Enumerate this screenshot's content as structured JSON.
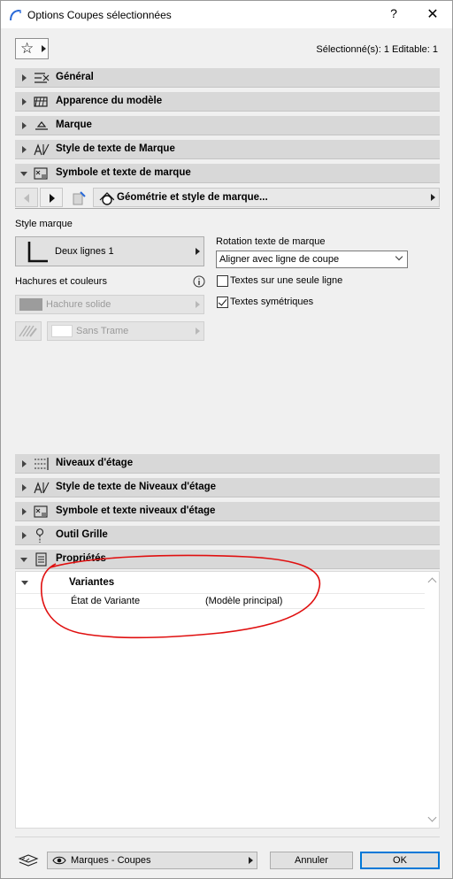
{
  "window": {
    "title": "Options Coupes sélectionnées",
    "help_glyph": "?",
    "close_glyph": "✕"
  },
  "toolbar": {
    "favorites_icon": "star-icon",
    "selection_info": "Sélectionné(s): 1 Editable: 1"
  },
  "panels": [
    {
      "label": "Général",
      "icon": "general-settings-icon",
      "expanded": false
    },
    {
      "label": "Apparence du modèle",
      "icon": "model-appearance-icon",
      "expanded": false
    },
    {
      "label": "Marque",
      "icon": "marker-icon",
      "expanded": false
    },
    {
      "label": "Style de texte de Marque",
      "icon": "text-style-icon",
      "expanded": false
    },
    {
      "label": "Symbole et texte de marque",
      "icon": "symbol-text-icon",
      "expanded": true
    }
  ],
  "subpage": {
    "label": "Géométrie et style de marque..."
  },
  "marker": {
    "style_label": "Style marque",
    "style_value": "Deux lignes 1",
    "hatch_label": "Hachures et couleurs",
    "fill_value": "Hachure solide",
    "pattern_value": "Sans Trame",
    "rotation_label": "Rotation texte de marque",
    "rotation_value": "Aligner avec ligne de coupe",
    "single_line_label": "Textes sur une seule ligne",
    "single_line_checked": false,
    "symmetric_label": "Textes symétriques",
    "symmetric_checked": true
  },
  "lower_panels": [
    {
      "label": "Niveaux d'étage",
      "icon": "story-levels-icon",
      "expanded": false
    },
    {
      "label": "Style de texte de Niveaux d'étage",
      "icon": "text-style-icon",
      "expanded": false
    },
    {
      "label": "Symbole et texte niveaux d'étage",
      "icon": "symbol-text-icon",
      "expanded": false
    },
    {
      "label": "Outil Grille",
      "icon": "grid-tool-icon",
      "expanded": false
    },
    {
      "label": "Propriétés",
      "icon": "properties-icon",
      "expanded": true
    }
  ],
  "properties": {
    "group_label": "Variantes",
    "row_name": "État de Variante",
    "row_value": "(Modèle principal)"
  },
  "footer": {
    "layer_icon": "layers-icon",
    "view_icon": "eye-icon",
    "view_value": "Marques - Coupes",
    "cancel_label": "Annuler",
    "ok_label": "OK"
  },
  "colors": {
    "panel_bg": "#d8d8d8",
    "annotation": "#e01010",
    "ok_border": "#0078d7"
  }
}
